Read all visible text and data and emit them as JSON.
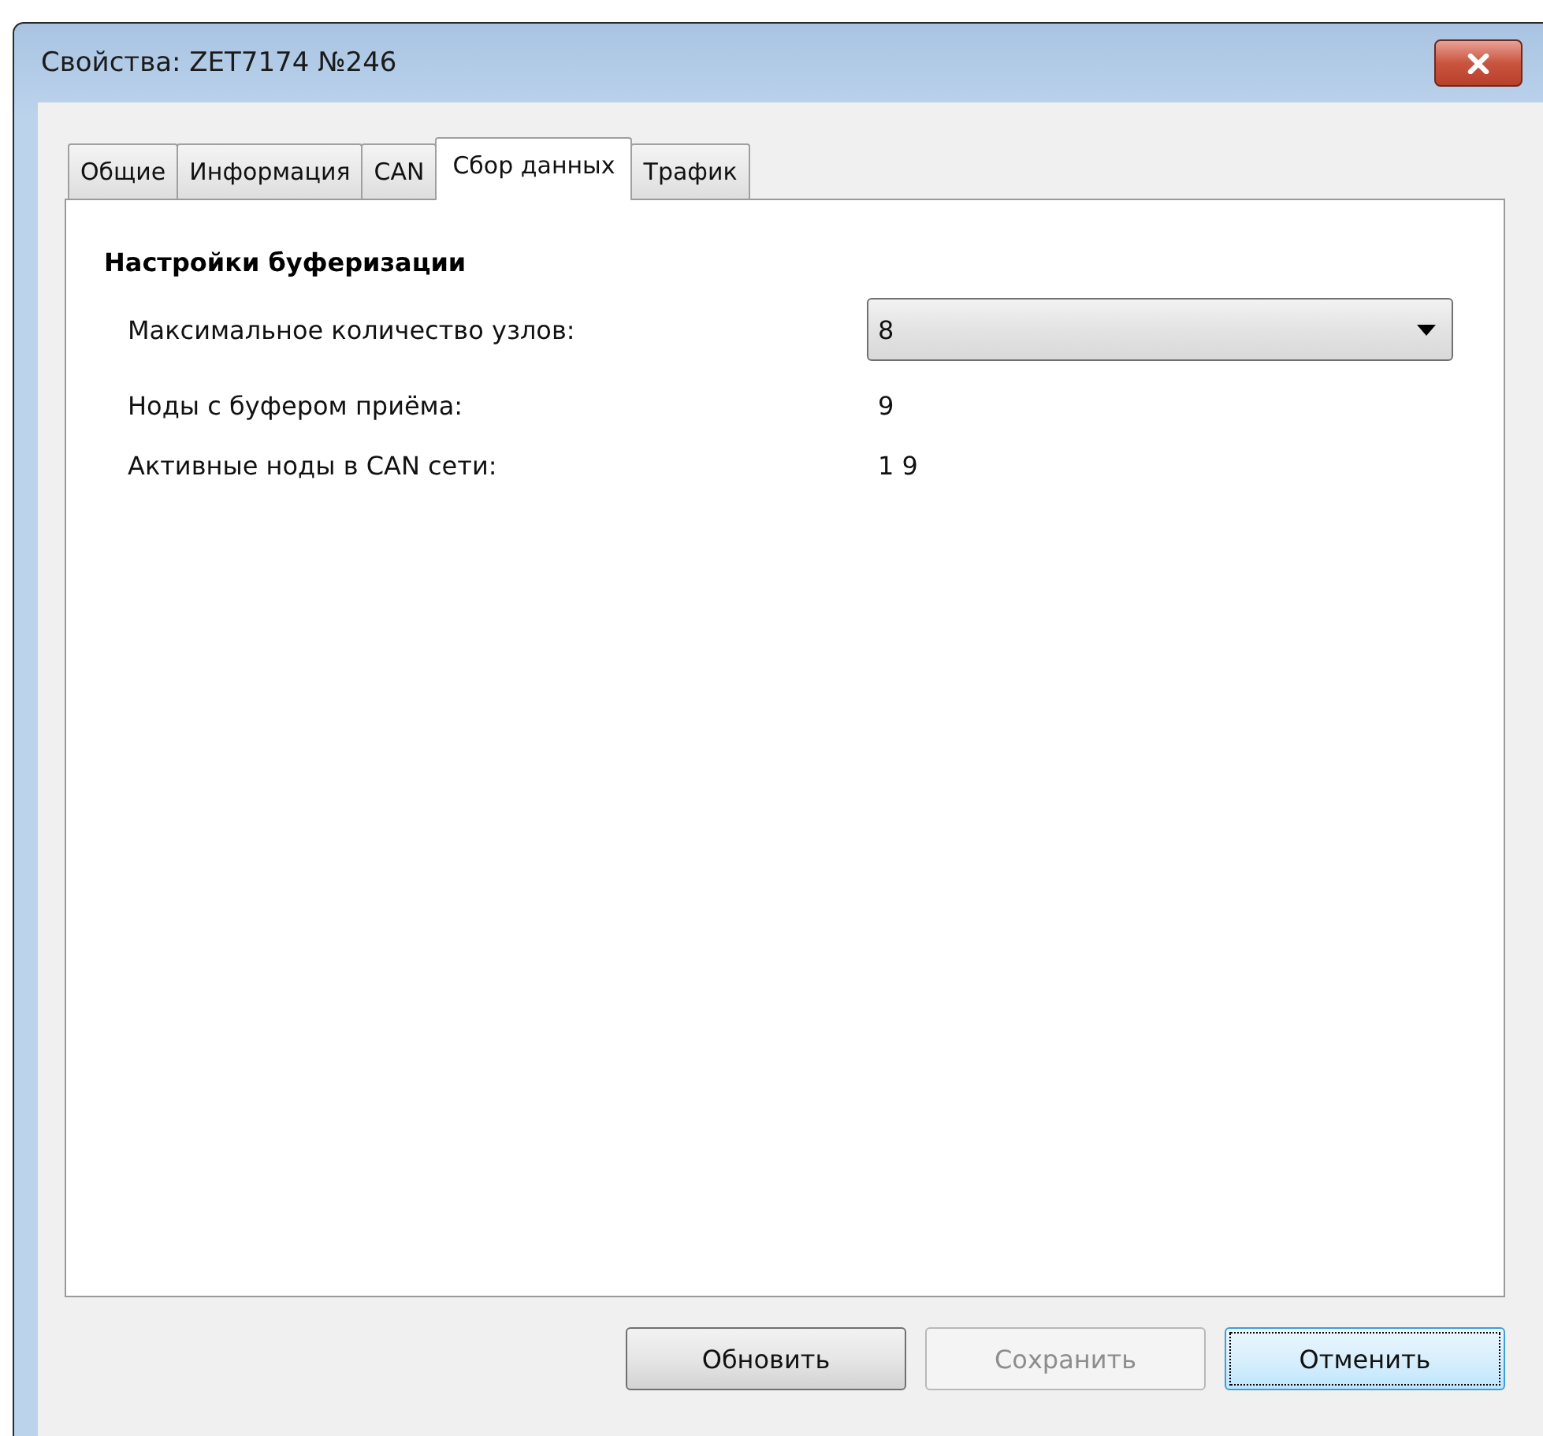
{
  "window": {
    "title": "Свойства: ZET7174 №246"
  },
  "tabs": [
    {
      "label": "Общие",
      "selected": false
    },
    {
      "label": "Информация",
      "selected": false
    },
    {
      "label": "CAN",
      "selected": false
    },
    {
      "label": "Сбор данных",
      "selected": true
    },
    {
      "label": "Трафик",
      "selected": false
    }
  ],
  "section": {
    "title": "Настройки буферизации"
  },
  "fields": [
    {
      "kind": "dropdown",
      "label": "Максимальное количество узлов:",
      "value": "8"
    },
    {
      "kind": "text",
      "label": "Ноды с буфером приёма:",
      "value": "9"
    },
    {
      "kind": "text",
      "label": "Активные ноды в CAN сети:",
      "value": "1 9"
    }
  ],
  "buttons": [
    {
      "label": "Обновить",
      "disabled": false,
      "focused": false
    },
    {
      "label": "Сохранить",
      "disabled": true,
      "focused": false
    },
    {
      "label": "Отменить",
      "disabled": false,
      "focused": true
    }
  ]
}
